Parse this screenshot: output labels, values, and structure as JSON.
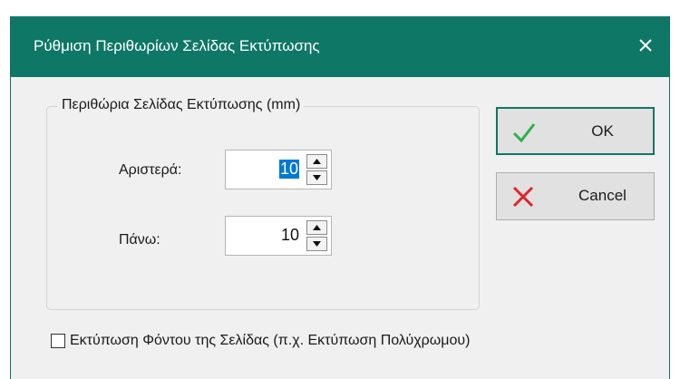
{
  "window": {
    "title": "Ρύθμιση Περιθωρίων Σελίδας Εκτύπωσης",
    "close_icon": "close-icon"
  },
  "group": {
    "legend": "Περιθώρια Σελίδας Εκτύπωσης (mm)",
    "left": {
      "label": "Αριστερά:",
      "value": "10"
    },
    "top": {
      "label": "Πάνω:",
      "value": "10"
    }
  },
  "buttons": {
    "ok": {
      "label": "OK",
      "icon": "checkmark-icon",
      "icon_color": "#2bb24c"
    },
    "cancel": {
      "label": "Cancel",
      "icon": "x-icon",
      "icon_color": "#e0232a"
    }
  },
  "background_checkbox": {
    "label": "Εκτύπωση Φόντου της Σελίδας (π.χ. Εκτύπωση Πολύχρωμου)",
    "checked": false
  },
  "colors": {
    "titlebar": "#0f7766",
    "selection": "#0078d7"
  }
}
